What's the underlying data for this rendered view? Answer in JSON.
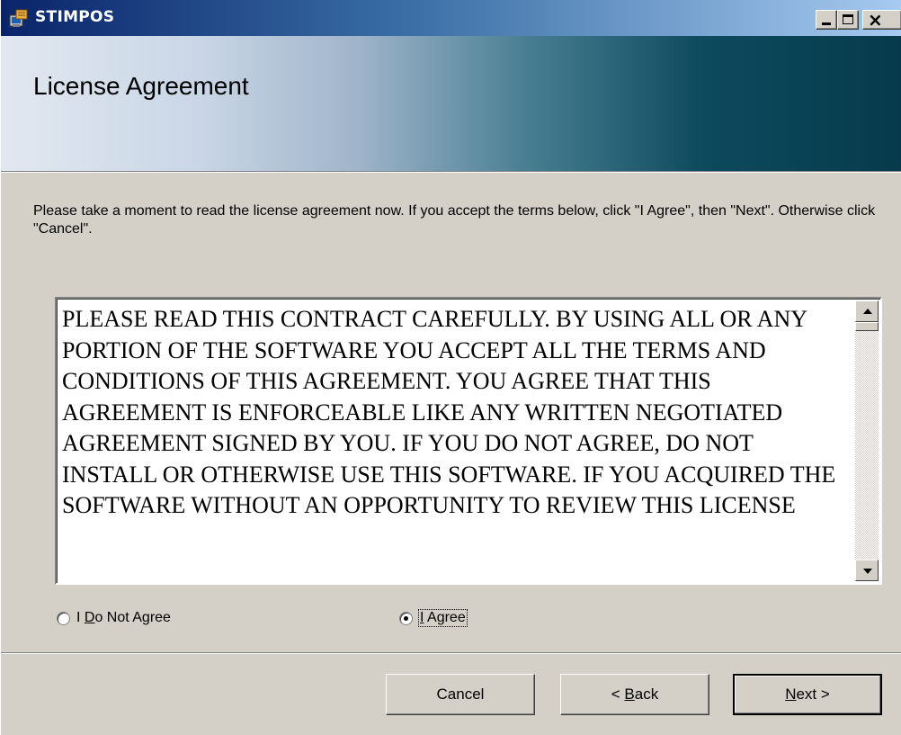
{
  "window": {
    "title": "STIMPOS",
    "icon": "installer-icon"
  },
  "banner": {
    "title": "License Agreement"
  },
  "instructions": "Please take a moment to read the license agreement now. If you accept the terms below, click \"I Agree\", then \"Next\". Otherwise click \"Cancel\".",
  "license": {
    "text": "PLEASE READ THIS CONTRACT CAREFULLY. BY USING ALL OR ANY PORTION OF THE SOFTWARE YOU ACCEPT ALL THE TERMS AND CONDITIONS OF THIS AGREEMENT. YOU AGREE THAT THIS AGREEMENT IS ENFORCEABLE LIKE ANY WRITTEN NEGOTIATED AGREEMENT SIGNED BY YOU. IF YOU DO NOT AGREE, DO NOT INSTALL OR OTHERWISE USE THIS SOFTWARE. IF YOU ACQUIRED THE SOFTWARE WITHOUT AN OPPORTUNITY TO REVIEW THIS LICENSE"
  },
  "options": {
    "not_agree": {
      "pre": "I ",
      "mnemonic": "D",
      "post": "o Not Agree",
      "selected": false
    },
    "agree": {
      "pre": "",
      "mnemonic": "I",
      "post": " Agree",
      "selected": true
    }
  },
  "buttons": {
    "cancel": "Cancel",
    "back": {
      "pre": "< ",
      "mnemonic": "B",
      "post": "ack"
    },
    "next": {
      "pre": "",
      "mnemonic": "N",
      "post": "ext >"
    }
  },
  "colors": {
    "titlebar_start": "#0a246a",
    "titlebar_end": "#a6caf0",
    "dialog_face": "#d4d0c8",
    "banner_dark": "#063a4b"
  }
}
